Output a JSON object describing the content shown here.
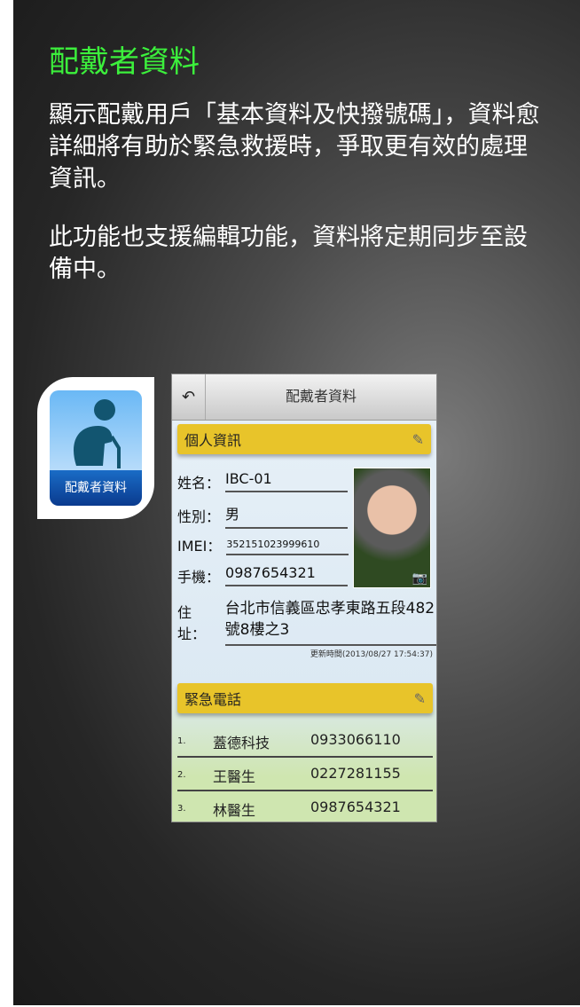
{
  "title": "配戴者資料",
  "description1": "顯示配戴用戶「基本資料及快撥號碼」，資料愈詳細將有助於緊急救援時，爭取更有效的處理資訊。",
  "description2": "此功能也支援編輯功能，資料將定期同步至設備中。",
  "app_icon_label": "配戴者資料",
  "screen": {
    "header_title": "配戴者資料",
    "personal_section": "個人資訊",
    "fields": [
      {
        "label": "姓名：",
        "value": "IBC-01"
      },
      {
        "label": "性別：",
        "value": "男"
      },
      {
        "label": "IMEI：",
        "value": "352151023999610"
      },
      {
        "label": "手機：",
        "value": "0987654321"
      },
      {
        "label": "住址：",
        "value": "台北市信義區忠孝東路五段482號8樓之3"
      }
    ],
    "updated": "更新時間(2013/08/27 17:54:37)",
    "emergency_section": "緊急電話",
    "contacts": [
      {
        "index": "1.",
        "name": "蓋德科技",
        "phone": "0933066110"
      },
      {
        "index": "2.",
        "name": "王醫生",
        "phone": "0227281155"
      },
      {
        "index": "3.",
        "name": "林醫生",
        "phone": "0987654321"
      }
    ]
  }
}
